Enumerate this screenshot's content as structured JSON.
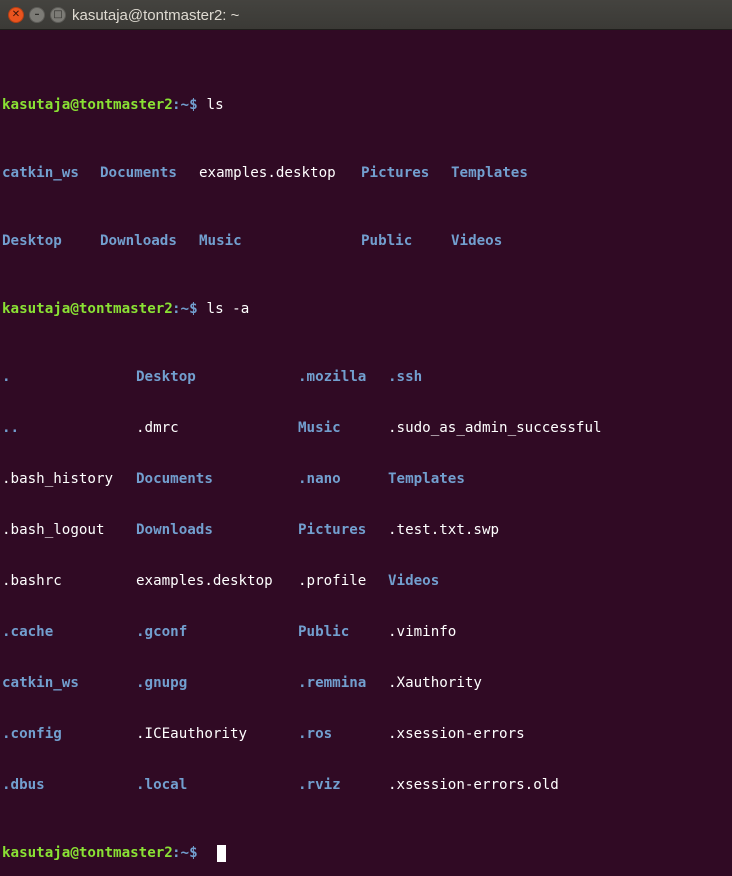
{
  "window": {
    "title": "kasutaja@tontmaster2: ~"
  },
  "colors": {
    "background": "#300a24",
    "prompt": "#8ae234",
    "directory": "#729fcf",
    "text": "#ffffff"
  },
  "titlebar": {
    "close_glyph": "✕",
    "minimize_glyph": "–",
    "maximize_glyph": "□"
  },
  "terminal": {
    "prompt": {
      "user_host": "kasutaja@tontmaster2",
      "path": ":~$"
    },
    "session": [
      {
        "command": " ls"
      },
      {
        "command": " ls -a"
      },
      {
        "command": ""
      }
    ],
    "ls": [
      [
        "catkin_ws",
        "Documents",
        "examples.desktop",
        "Pictures",
        "Templates"
      ],
      [
        "Desktop",
        "Downloads",
        "Music",
        "Public",
        "Videos"
      ]
    ],
    "ls_a": [
      [
        ".",
        "Desktop",
        ".mozilla",
        ".ssh"
      ],
      [
        "..",
        ".dmrc",
        "Music",
        ".sudo_as_admin_successful"
      ],
      [
        ".bash_history",
        "Documents",
        ".nano",
        "Templates"
      ],
      [
        ".bash_logout",
        "Downloads",
        "Pictures",
        ".test.txt.swp"
      ],
      [
        ".bashrc",
        "examples.desktop",
        ".profile",
        "Videos"
      ],
      [
        ".cache",
        ".gconf",
        "Public",
        ".viminfo"
      ],
      [
        "catkin_ws",
        ".gnupg",
        ".remmina",
        ".Xauthority"
      ],
      [
        ".config",
        ".ICEauthority",
        ".ros",
        ".xsession-errors"
      ],
      [
        ".dbus",
        ".local",
        ".rviz",
        ".xsession-errors.old"
      ]
    ]
  }
}
